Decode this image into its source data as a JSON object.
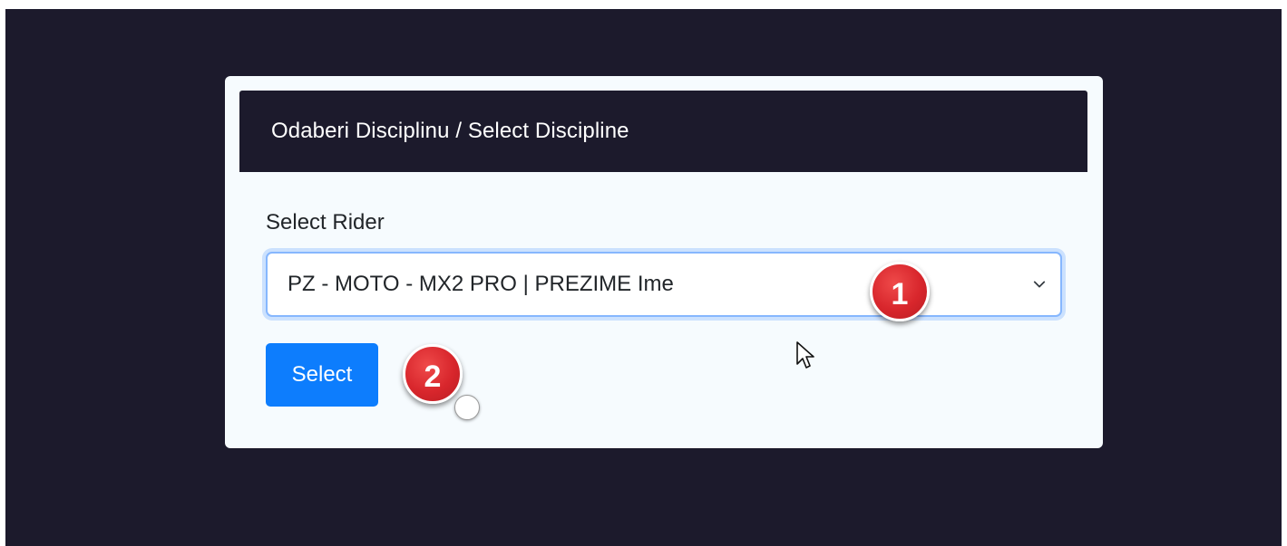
{
  "card": {
    "title": "Odaberi Disciplinu / Select Discipline"
  },
  "rider_select": {
    "label": "Select Rider",
    "selected_value": "PZ - MOTO - MX2 PRO | PREZIME Ime"
  },
  "actions": {
    "select_label": "Select"
  },
  "annotations": {
    "step1_label": "1",
    "step2_label": "2"
  },
  "colors": {
    "background": "#1c1a2c",
    "card": "#f6fbfe",
    "header": "#1c1a2c",
    "button": "#0d7dfd",
    "badge": "#d8262c",
    "focus_border": "#86b7fe"
  },
  "icons": {
    "dropdown": "chevron-down-icon",
    "cursor": "mouse-pointer-icon"
  }
}
